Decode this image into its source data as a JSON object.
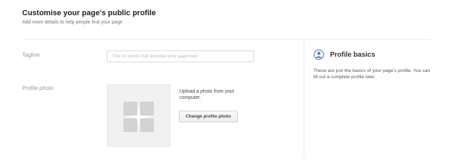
{
  "header": {
    "title": "Customise your page's public profile",
    "subtitle": "Add more details to help people find your page"
  },
  "form": {
    "tagline": {
      "label": "Tagline",
      "value": "",
      "placeholder": "The 10 words that describe your page best"
    },
    "profile_photo": {
      "label": "Profile photo",
      "upload_text": "Upload a photo from your computer.",
      "change_button_label": "Change profile photo",
      "icon": "photo-placeholder-icon"
    }
  },
  "sidebar": {
    "title": "Profile basics",
    "icon": "person-circle-icon",
    "text": "These are just the basics of your page's profile. You can fill out a complete profile later."
  },
  "colors": {
    "divider": "#ebebeb",
    "label": "#999999",
    "photo_bg": "#f1f1f1",
    "icon_blue": "#7b96b8"
  }
}
